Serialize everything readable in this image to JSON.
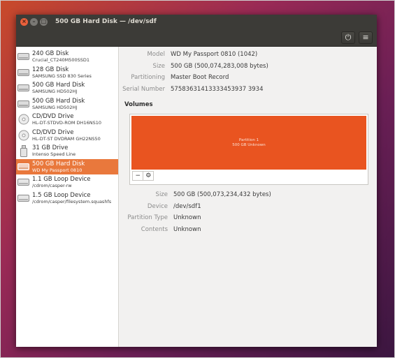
{
  "window": {
    "title": "500 GB Hard Disk — /dev/sdf",
    "close_glyph": "×",
    "min_glyph": "–",
    "max_glyph": "□"
  },
  "toolbar": {
    "power_glyph": "⏻",
    "menu_glyph": "≡"
  },
  "drives": [
    {
      "name": "240 GB Disk",
      "sub": "Crucial_CT240M500SSD1",
      "icon": "disk-icon"
    },
    {
      "name": "128 GB Disk",
      "sub": "SAMSUNG SSD 830 Series",
      "icon": "disk-icon"
    },
    {
      "name": "500 GB Hard Disk",
      "sub": "SAMSUNG HD502HJ",
      "icon": "disk-icon"
    },
    {
      "name": "500 GB Hard Disk",
      "sub": "SAMSUNG HD502HJ",
      "icon": "disk-icon"
    },
    {
      "name": "CD/DVD Drive",
      "sub": "HL-DT-STDVD-ROM DH16NS10",
      "icon": "optical-disc-icon"
    },
    {
      "name": "CD/DVD Drive",
      "sub": "HL-DT-ST DVDRAM GH22NS50",
      "icon": "optical-disc-icon"
    },
    {
      "name": "31 GB Drive",
      "sub": "Intenso Speed Line",
      "icon": "usb-drive-icon"
    },
    {
      "name": "500 GB Hard Disk",
      "sub": "WD My Passport 0810",
      "icon": "disk-icon",
      "selected": true
    },
    {
      "name": "1.1 GB Loop Device",
      "sub": "/cdrom/casper-rw",
      "icon": "loop-device-icon"
    },
    {
      "name": "1.5 GB Loop Device",
      "sub": "/cdrom/casper/filesystem.squashfs",
      "icon": "loop-device-icon"
    }
  ],
  "details": {
    "model_label": "Model",
    "model": "WD My Passport 0810 (1042)",
    "size_label": "Size",
    "size": "500 GB (500,074,283,008 bytes)",
    "partitioning_label": "Partitioning",
    "partitioning": "Master Boot Record",
    "serial_label": "Serial Number",
    "serial": "57583631413333453937 3934"
  },
  "volumes": {
    "title": "Volumes",
    "partition_name": "Partition 1",
    "partition_size": "500 GB Unknown",
    "minus_glyph": "−",
    "settings_glyph": "⚙"
  },
  "partition_info": {
    "size_label": "Size",
    "size": "500 GB (500,073,234,432 bytes)",
    "device_label": "Device",
    "device": "/dev/sdf1",
    "type_label": "Partition Type",
    "type": "Unknown",
    "contents_label": "Contents",
    "contents": "Unknown"
  },
  "colors": {
    "accent": "#e95420",
    "selection": "#e9783c",
    "titlebar": "#3c3b37"
  }
}
